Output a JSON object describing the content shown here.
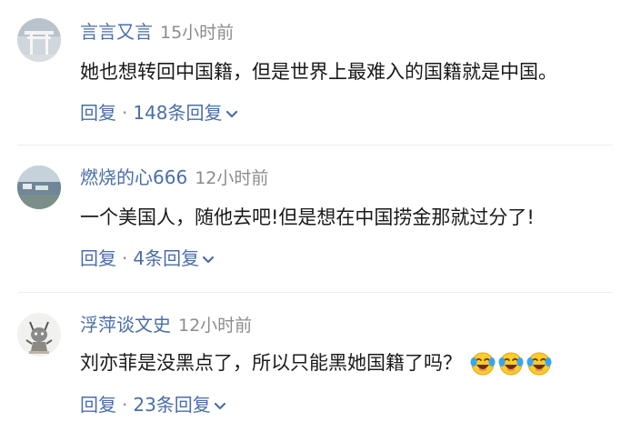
{
  "comments": [
    {
      "username": "言言又言",
      "time": "15小时前",
      "content": "她也想转回中国籍，但是世界上最难入的国籍就是中国。",
      "reply_label": "回复",
      "separator": "·",
      "replies_label": "148条回复",
      "avatar_icon": "shrine-gate-avatar",
      "emojis": []
    },
    {
      "username": "燃烧的心666",
      "time": "12小时前",
      "content": "一个美国人，随他去吧!但是想在中国捞金那就过分了!",
      "reply_label": "回复",
      "separator": "·",
      "replies_label": "4条回复",
      "avatar_icon": "landscape-avatar",
      "emojis": []
    },
    {
      "username": "浮萍谈文史",
      "time": "12小时前",
      "content": "刘亦菲是没黑点了，所以只能黑她国籍了吗？",
      "reply_label": "回复",
      "separator": "·",
      "replies_label": "23条回复",
      "avatar_icon": "cartoon-animal-avatar",
      "emojis": [
        "crying-laughing-emoji",
        "crying-laughing-emoji",
        "crying-laughing-emoji"
      ]
    }
  ],
  "colors": {
    "username": "#4a6ea9",
    "time": "#8c8c8c",
    "content": "#1a1a1a",
    "reply": "#4a6ea9",
    "divider": "#ededed"
  }
}
